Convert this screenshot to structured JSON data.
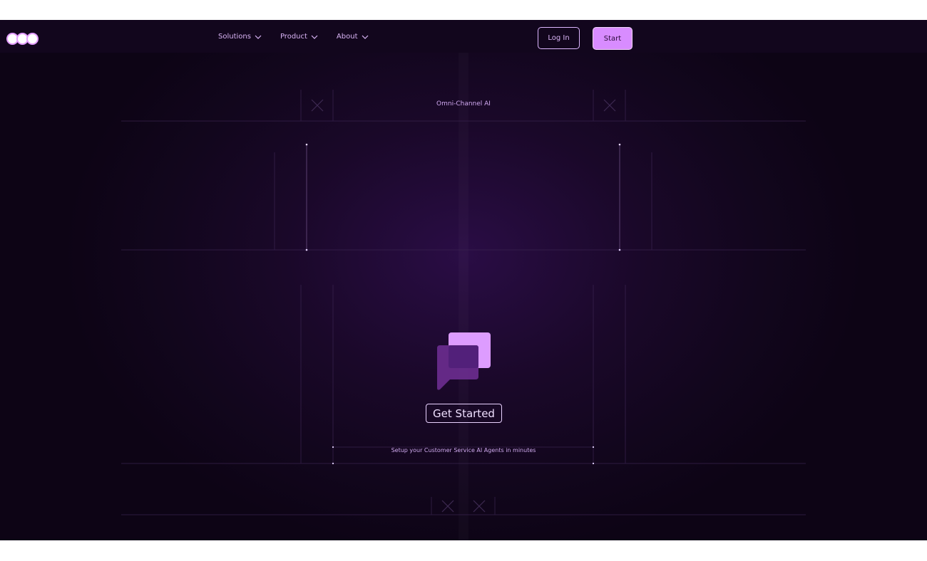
{
  "nav": {
    "items": [
      {
        "label": "Solutions"
      },
      {
        "label": "Product"
      },
      {
        "label": "About"
      }
    ],
    "login_label": "Log In",
    "start_label": "Start"
  },
  "hero": {
    "eyebrow": "Omni-Channel AI",
    "cta_label": "Get Started",
    "subline": "Setup your Customer Service AI Agents in minutes"
  },
  "icons": {
    "logo": "logo-circles-icon",
    "chevron": "chevron-down-icon",
    "hero": "chat-bubbles-icon",
    "decor": "x-mark-icon"
  },
  "colors": {
    "accent": "#d88cff",
    "background": "#12061d",
    "text": "#d9b4f5"
  }
}
